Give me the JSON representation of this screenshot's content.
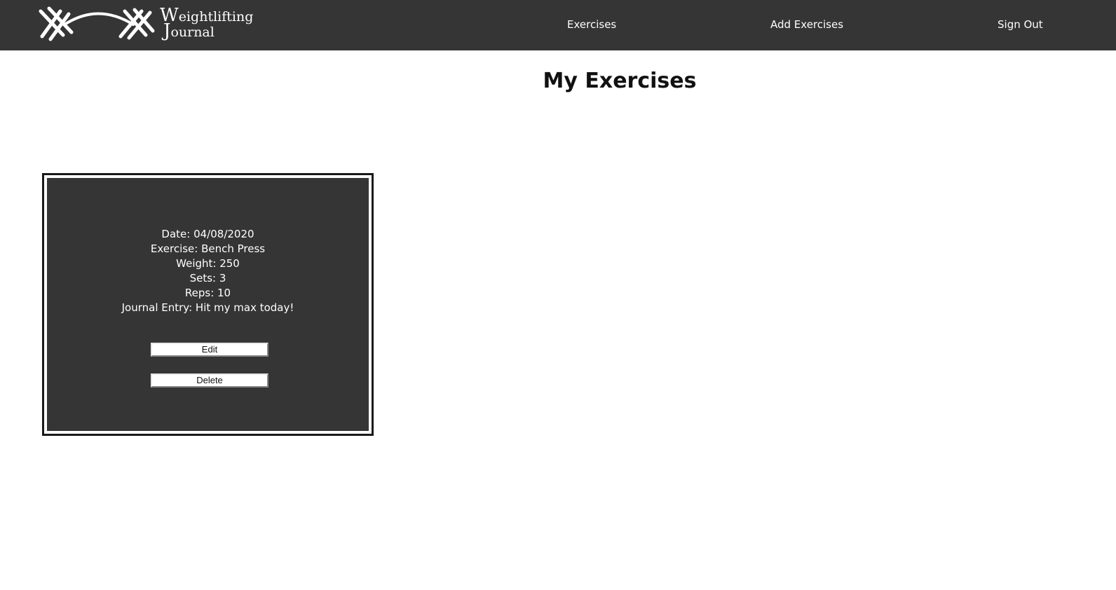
{
  "navbar": {
    "logo": {
      "line1_cap": "W",
      "line1_rest": "eightlifting",
      "line2_cap": "J",
      "line2_rest": "ournal"
    },
    "links": {
      "exercises": "Exercises",
      "add_exercises": "Add Exercises",
      "sign_out": "Sign Out"
    }
  },
  "main": {
    "title": "My Exercises"
  },
  "exercise_card": {
    "date": "Date: 04/08/2020",
    "exercise": "Exercise: Bench Press",
    "weight": "Weight: 250",
    "sets": "Sets: 3",
    "reps": "Reps: 10",
    "journal": "Journal Entry: Hit my max today!",
    "edit_label": "Edit",
    "delete_label": "Delete"
  },
  "colors": {
    "navbar_bg": "#353535",
    "card_bg": "#353535",
    "text_light": "#ffffff",
    "page_bg": "#ffffff"
  },
  "icons": {
    "logo": "barbell-icon"
  }
}
